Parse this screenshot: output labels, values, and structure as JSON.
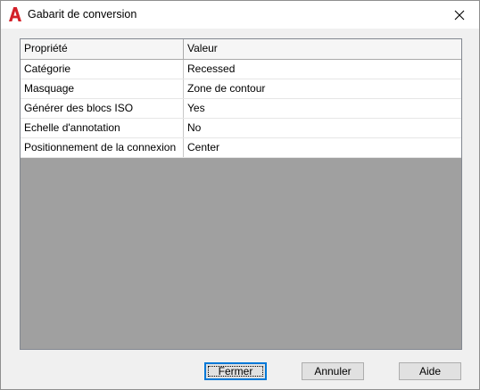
{
  "window": {
    "title": "Gabarit de conversion",
    "app_icon": "autocad-a-icon",
    "accent_color": "#d32029"
  },
  "grid": {
    "headers": [
      "Propriété",
      "Valeur"
    ],
    "rows": [
      {
        "property": "Catégorie",
        "value": "Recessed"
      },
      {
        "property": "Masquage",
        "value": "Zone de contour"
      },
      {
        "property": "Générer des blocs ISO",
        "value": "Yes"
      },
      {
        "property": "Echelle d'annotation",
        "value": "No"
      },
      {
        "property": "Positionnement de la connexion",
        "value": "Center"
      }
    ]
  },
  "buttons": {
    "close_label": "Fermer",
    "cancel_label": "Annuler",
    "help_label": "Aide"
  }
}
